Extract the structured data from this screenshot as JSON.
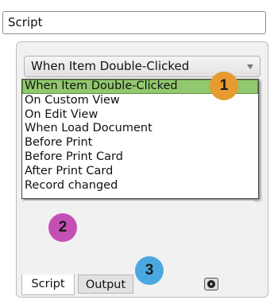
{
  "header": {
    "field_value": "Script"
  },
  "event_select": {
    "selected": "When Item Double-Clicked",
    "options": [
      "When Item Double-Clicked",
      "On Custom View",
      "On Edit View",
      "When Load Document",
      "Before Print",
      "Before Print Card",
      "After Print Card",
      "Record changed"
    ]
  },
  "callouts": [
    {
      "label": "1",
      "color": "#e59b2f"
    },
    {
      "label": "2",
      "color": "#c550b5"
    },
    {
      "label": "3",
      "color": "#4aa8e0"
    }
  ],
  "tabs": [
    {
      "label": "Script",
      "active": true
    },
    {
      "label": "Output",
      "active": false
    }
  ],
  "toolbar": {
    "run_icon": "play-circle-icon"
  },
  "colors": {
    "selected_option": "#92c86f",
    "panel_background": "#f1f1f1"
  }
}
